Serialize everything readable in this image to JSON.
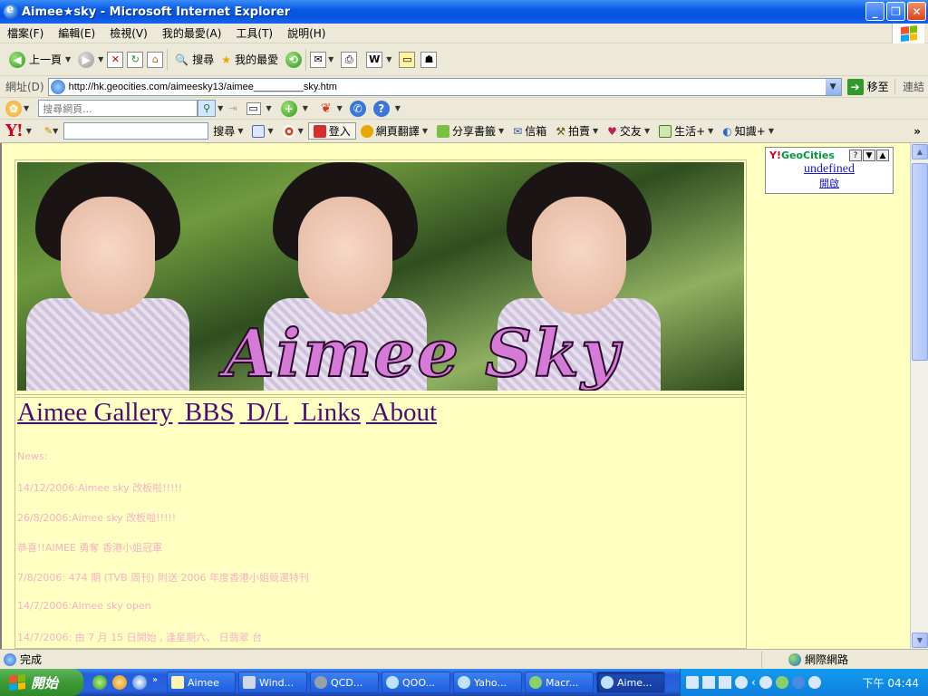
{
  "window": {
    "title": "Aimee★sky - Microsoft Internet Explorer",
    "controls": [
      "_",
      "❐",
      "✕"
    ]
  },
  "menu": [
    "檔案(F)",
    "編輯(E)",
    "檢視(V)",
    "我的最愛(A)",
    "工具(T)",
    "說明(H)"
  ],
  "toolbar": {
    "back": "上一頁",
    "search": "搜尋",
    "favorites": "我的最愛"
  },
  "address": {
    "label": "網址(D)",
    "url": "http://hk.geocities.com/aimeesky13/aimee_________sky.htm",
    "go": "移至",
    "links": "連結"
  },
  "searchbar": {
    "placeholder": "搜尋網頁..."
  },
  "yahoo": {
    "logo": "Y!",
    "search": "搜尋",
    "login": "登入",
    "buttons": [
      "網頁翻譯",
      "分享書籤",
      "信箱",
      "拍賣",
      "交友",
      "生活+",
      "知識+"
    ],
    "more": "»"
  },
  "geocities": {
    "brand_y": "Y!",
    "brand": "GeoCities",
    "buttons": [
      "?",
      "▼",
      "▲"
    ],
    "undefined": "undefined",
    "open": "開啟"
  },
  "banner": {
    "text": "Aimee Sky"
  },
  "nav": [
    "Aimee Gallery",
    "BBS",
    "D/L",
    "Links",
    "About"
  ],
  "news": [
    "News:",
    "14/12/2006:Aimee sky 改板啦!!!!!",
    "26/8/2006:Aimee sky 改板啦!!!!!",
    "恭喜!!AIMEE 勇奪 香港小姐冠軍",
    "7/8/2006: 474 期 (TVB 周刊) 附送 2006 年度香港小姐競選特刊",
    "14/7/2006:Aimee sky open",
    "14/7/2006: 由 7 月 15 日開始 , 逢星期六、 日翡翠 台"
  ],
  "status": {
    "text": "完成",
    "zone": "網際網路"
  },
  "taskbar": {
    "start": "開始",
    "tasks": [
      "Aimee",
      "Wind...",
      "QCD...",
      "QOO...",
      "Yaho...",
      "Macr...",
      "Aime..."
    ],
    "active_index": 6,
    "clock": "下午 04:44"
  },
  "colors": {
    "page_bg": "#ffffc2",
    "nav_link": "#4b0c73",
    "news_text": "#f4b2c8",
    "title_bar": "#0a5ae6"
  }
}
